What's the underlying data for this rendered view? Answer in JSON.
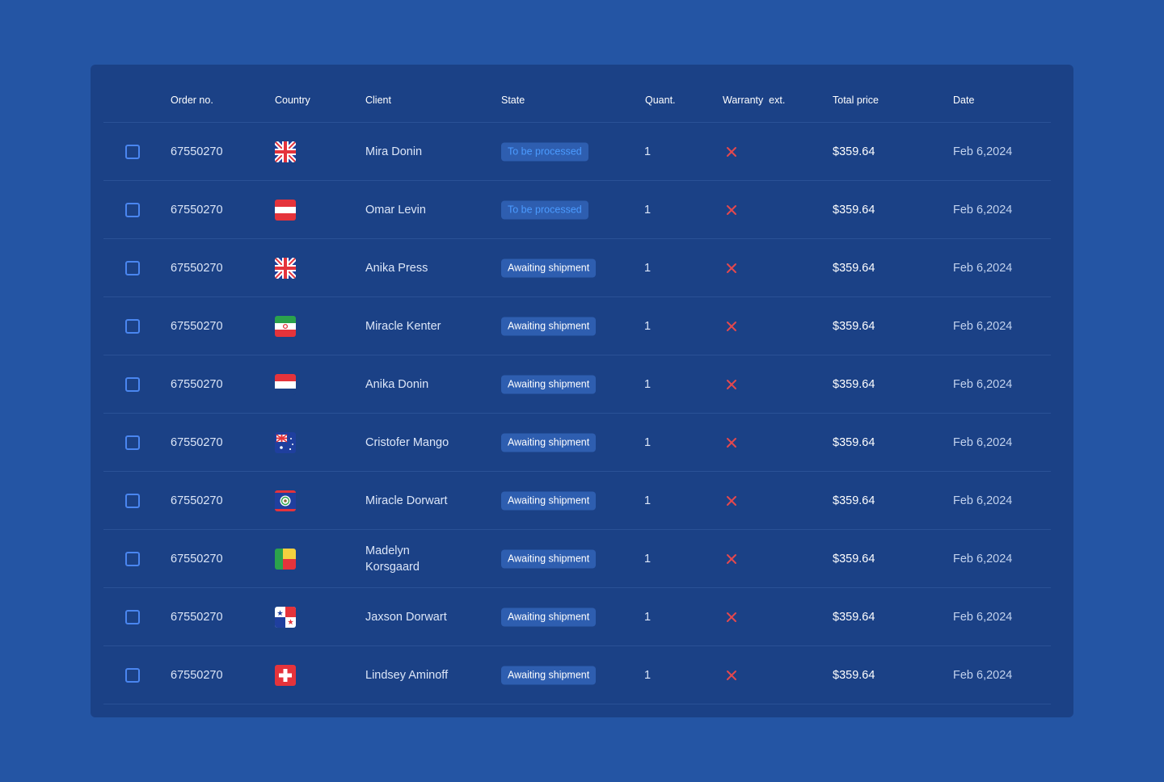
{
  "columns": {
    "order": "Order no.",
    "country": "Country",
    "client": "Client",
    "state": "State",
    "quantity": "Quant.",
    "warranty": "Warranty  ext.",
    "price": "Total price",
    "date": "Date"
  },
  "colors": {
    "background": "#2455A4",
    "card": "#1B4186",
    "checkbox": "#4A86F0",
    "pill_bg": "#2E5EB0",
    "processed_text": "#4B9BFF",
    "cross": "#E5484D"
  },
  "rows": [
    {
      "order": "67550270",
      "flag": "uk-flag-icon",
      "client": "Mira Donin",
      "state": "To be processed",
      "state_kind": "processed",
      "quantity": "1",
      "warranty": "cross-icon",
      "price": "$359.64",
      "date": "Feb 6,2024"
    },
    {
      "order": "67550270",
      "flag": "austria-flag-icon",
      "client": "Omar Levin",
      "state": "To be processed",
      "state_kind": "processed",
      "quantity": "1",
      "warranty": "cross-icon",
      "price": "$359.64",
      "date": "Feb 6,2024"
    },
    {
      "order": "67550270",
      "flag": "uk-flag-icon",
      "client": "Anika Press",
      "state": "Awaiting shipment",
      "state_kind": "awaiting",
      "quantity": "1",
      "warranty": "cross-icon",
      "price": "$359.64",
      "date": "Feb 6,2024"
    },
    {
      "order": "67550270",
      "flag": "iran-flag-icon",
      "client": "Miracle Kenter",
      "state": "Awaiting shipment",
      "state_kind": "awaiting",
      "quantity": "1",
      "warranty": "cross-icon",
      "price": "$359.64",
      "date": "Feb 6,2024"
    },
    {
      "order": "67550270",
      "flag": "indonesia-flag-icon",
      "client": "Anika Donin",
      "state": "Awaiting shipment",
      "state_kind": "awaiting",
      "quantity": "1",
      "warranty": "cross-icon",
      "price": "$359.64",
      "date": "Feb 6,2024"
    },
    {
      "order": "67550270",
      "flag": "australia-flag-icon",
      "client": "Cristofer Mango",
      "state": "Awaiting shipment",
      "state_kind": "awaiting",
      "quantity": "1",
      "warranty": "cross-icon",
      "price": "$359.64",
      "date": "Feb 6,2024"
    },
    {
      "order": "67550270",
      "flag": "belize-flag-icon",
      "client": "Miracle Dorwart",
      "state": "Awaiting shipment",
      "state_kind": "awaiting",
      "quantity": "1",
      "warranty": "cross-icon",
      "price": "$359.64",
      "date": "Feb 6,2024"
    },
    {
      "order": "67550270",
      "flag": "benin-flag-icon",
      "client": "Madelyn\nKorsgaard",
      "state": "Awaiting shipment",
      "state_kind": "awaiting",
      "quantity": "1",
      "warranty": "cross-icon",
      "price": "$359.64",
      "date": "Feb 6,2024"
    },
    {
      "order": "67550270",
      "flag": "panama-flag-icon",
      "client": "Jaxson Dorwart",
      "state": "Awaiting shipment",
      "state_kind": "awaiting",
      "quantity": "1",
      "warranty": "cross-icon",
      "price": "$359.64",
      "date": "Feb 6,2024"
    },
    {
      "order": "67550270",
      "flag": "switzerland-flag-icon",
      "client": "Lindsey Aminoff",
      "state": "Awaiting shipment",
      "state_kind": "awaiting",
      "quantity": "1",
      "warranty": "cross-icon",
      "price": "$359.64",
      "date": "Feb 6,2024"
    }
  ]
}
